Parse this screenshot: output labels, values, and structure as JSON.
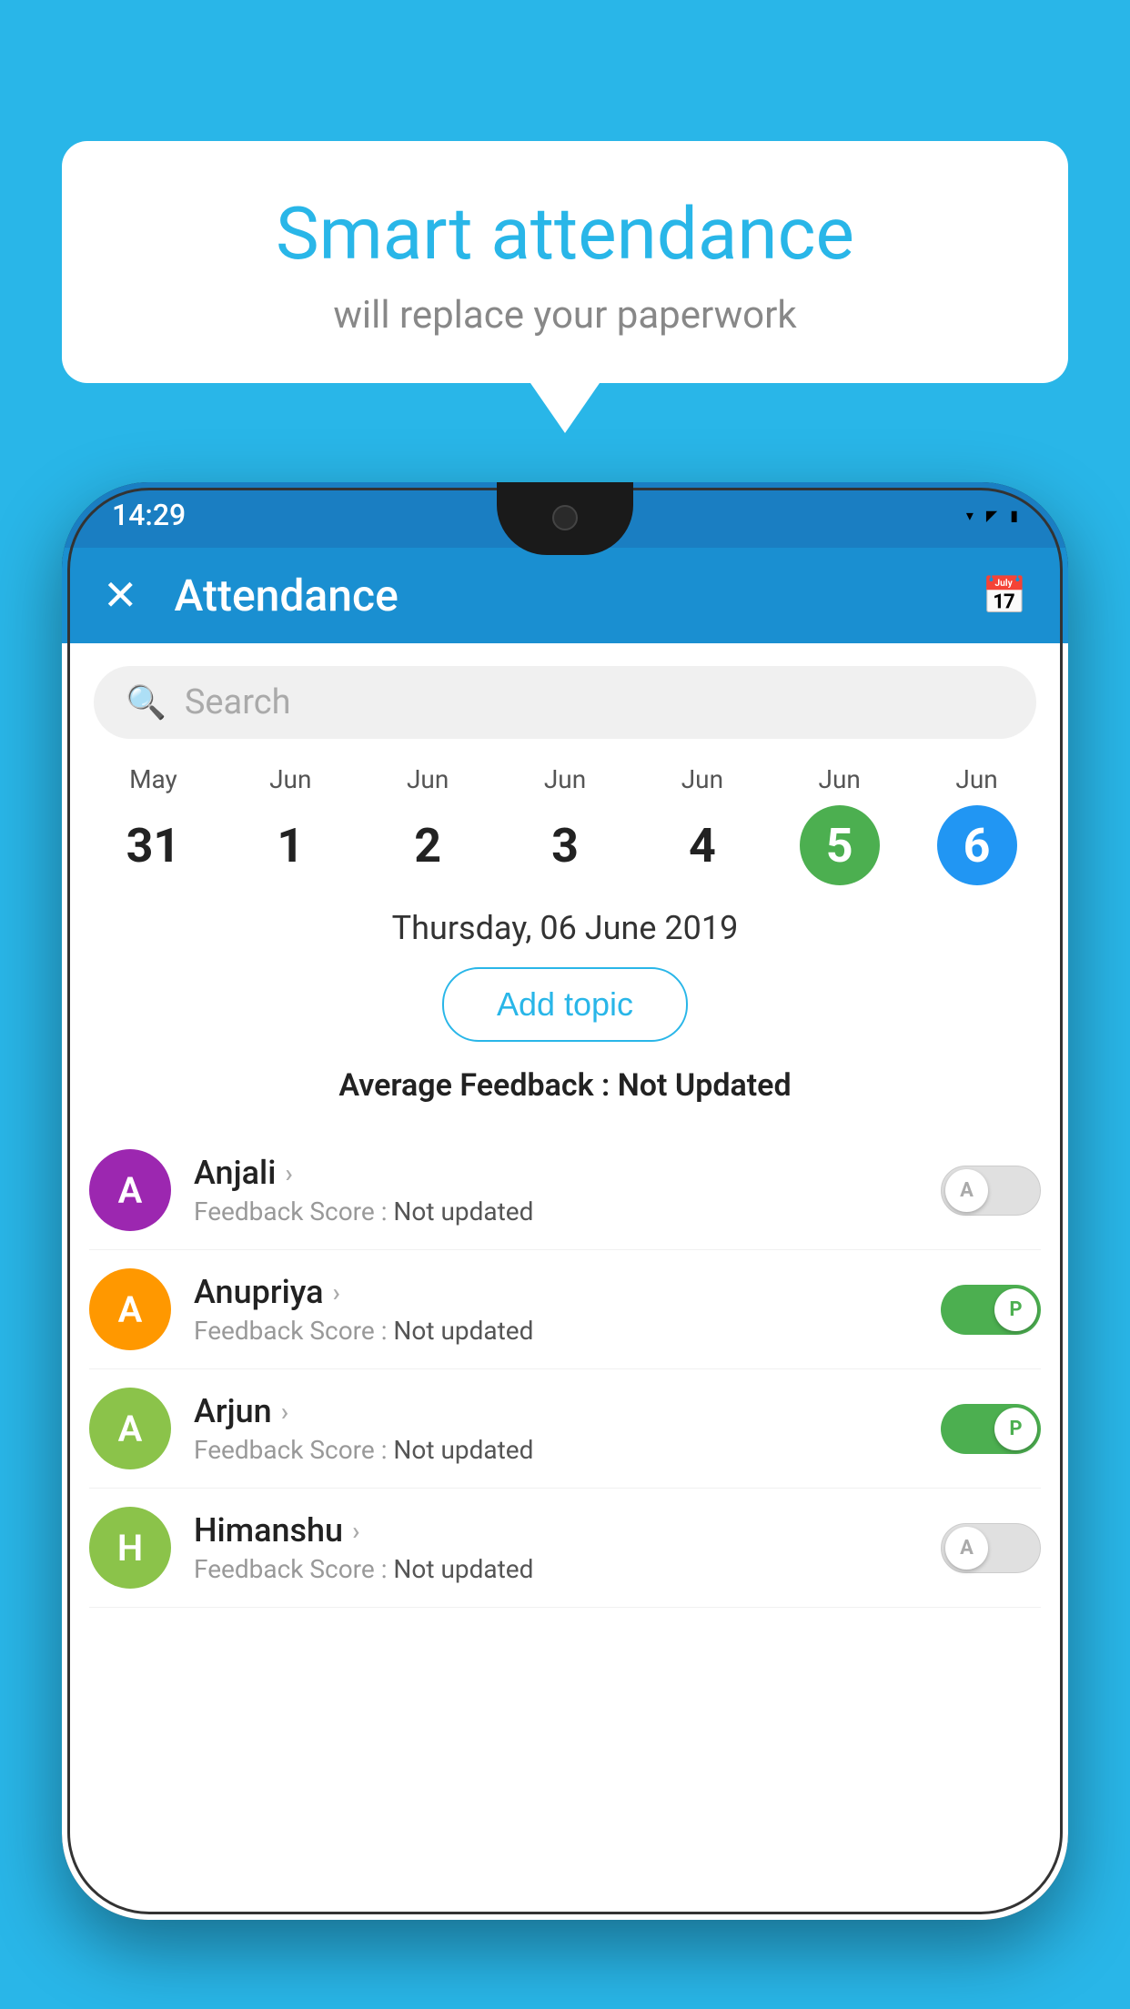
{
  "background_color": "#29b6e8",
  "hero": {
    "title": "Smart attendance",
    "subtitle": "will replace your paperwork"
  },
  "phone": {
    "status_bar": {
      "time": "14:29",
      "wifi": "▾",
      "signal": "▲",
      "battery": "▮"
    },
    "app_bar": {
      "title": "Attendance",
      "close_icon": "✕",
      "calendar_icon": "📅"
    },
    "search_placeholder": "Search",
    "calendar": {
      "days": [
        {
          "month": "May",
          "date": "31",
          "style": "normal"
        },
        {
          "month": "Jun",
          "date": "1",
          "style": "normal"
        },
        {
          "month": "Jun",
          "date": "2",
          "style": "normal"
        },
        {
          "month": "Jun",
          "date": "3",
          "style": "normal"
        },
        {
          "month": "Jun",
          "date": "4",
          "style": "normal"
        },
        {
          "month": "Jun",
          "date": "5",
          "style": "green"
        },
        {
          "month": "Jun",
          "date": "6",
          "style": "blue"
        }
      ]
    },
    "selected_date": "Thursday, 06 June 2019",
    "add_topic_label": "Add topic",
    "average_feedback_label": "Average Feedback : ",
    "average_feedback_value": "Not Updated",
    "students": [
      {
        "name": "Anjali",
        "avatar_letter": "A",
        "avatar_color": "#9c27b0",
        "feedback_label": "Feedback Score : ",
        "feedback_value": "Not updated",
        "toggle": "off",
        "toggle_letter": "A"
      },
      {
        "name": "Anupriya",
        "avatar_letter": "A",
        "avatar_color": "#ff9800",
        "feedback_label": "Feedback Score : ",
        "feedback_value": "Not updated",
        "toggle": "on",
        "toggle_letter": "P"
      },
      {
        "name": "Arjun",
        "avatar_letter": "A",
        "avatar_color": "#8bc34a",
        "feedback_label": "Feedback Score : ",
        "feedback_value": "Not updated",
        "toggle": "on",
        "toggle_letter": "P"
      },
      {
        "name": "Himanshu",
        "avatar_letter": "H",
        "avatar_color": "#8bc34a",
        "feedback_label": "Feedback Score : ",
        "feedback_value": "Not updated",
        "toggle": "off",
        "toggle_letter": "A"
      }
    ]
  }
}
